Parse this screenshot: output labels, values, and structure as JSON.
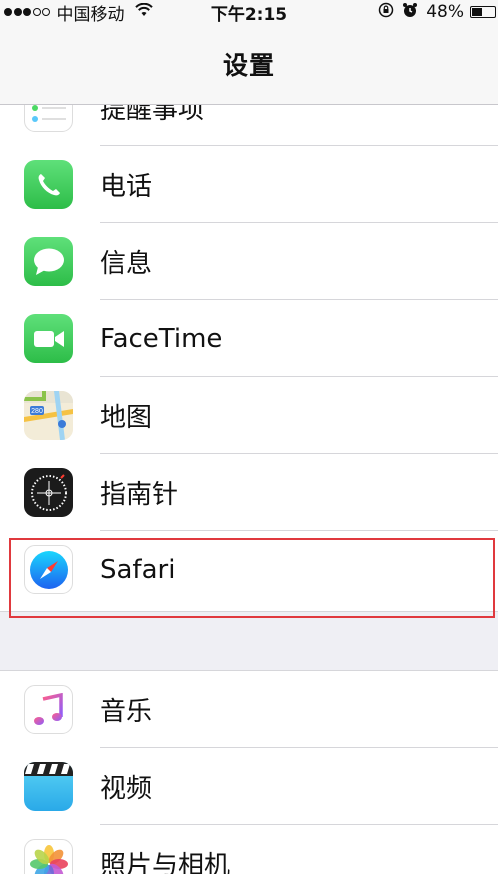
{
  "status_bar": {
    "carrier": "中国移动",
    "time": "下午2:15",
    "battery_text": "48%",
    "battery_level": 0.48,
    "icons": [
      "signal-dots",
      "wifi-icon",
      "orientation-lock-icon",
      "alarm-icon",
      "battery-icon"
    ]
  },
  "nav": {
    "title": "设置"
  },
  "group1": {
    "items": [
      {
        "label": "提醒事项",
        "icon": "reminders-icon"
      },
      {
        "label": "电话",
        "icon": "phone-icon"
      },
      {
        "label": "信息",
        "icon": "messages-icon"
      },
      {
        "label": "FaceTime",
        "icon": "facetime-icon"
      },
      {
        "label": "地图",
        "icon": "maps-icon"
      },
      {
        "label": "指南针",
        "icon": "compass-icon"
      },
      {
        "label": "Safari",
        "icon": "safari-icon"
      }
    ]
  },
  "group2": {
    "items": [
      {
        "label": "音乐",
        "icon": "music-icon"
      },
      {
        "label": "视频",
        "icon": "videos-icon"
      },
      {
        "label": "照片与相机",
        "icon": "photos-icon"
      }
    ]
  },
  "colors": {
    "background": "#efeff4",
    "highlight": "#e0393e",
    "green_app": "#34c84a"
  }
}
